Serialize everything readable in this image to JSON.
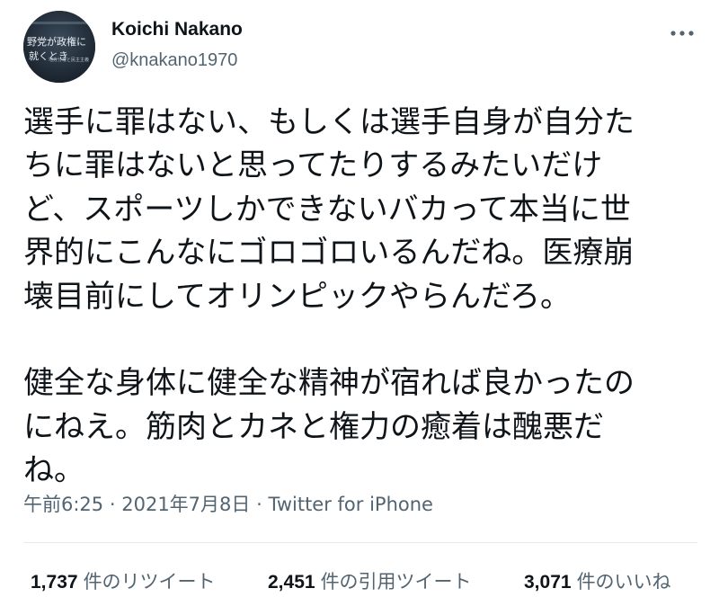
{
  "author": {
    "display_name": "Koichi Nakano",
    "handle": "@knakano1970",
    "avatar_text_lines": [
      "野党が政権に",
      "就くとき",
      "地方分権と民主主義"
    ]
  },
  "tweet": {
    "text": "選手に罪はない、もしくは選手自身が自分た\nちに罪はないと思ってたりするみたいだけ\nど、スポーツしかできないバカって本当に世\n界的にこんなにゴロゴロいるんだね。医療崩\n壊目前にしてオリンピックやらんだろ。\n\n健全な身体に健全な精神が宿れば良かったの\nにねえ。筋肉とカネと権力の癒着は醜悪だ\nね。",
    "time": "午前6:25",
    "separator": "·",
    "date": "2021年7月8日",
    "source": "Twitter for iPhone"
  },
  "stats": {
    "retweets": {
      "count": "1,737",
      "label": "件のリツイート"
    },
    "quotes": {
      "count": "2,451",
      "label": "件の引用ツイート"
    },
    "likes": {
      "count": "3,071",
      "label": "件のいいね"
    }
  },
  "icons": {
    "more": "more-horizontal-icon"
  },
  "colors": {
    "primary_text": "#0f1419",
    "secondary_text": "#536471",
    "divider": "#e7e9ea"
  }
}
